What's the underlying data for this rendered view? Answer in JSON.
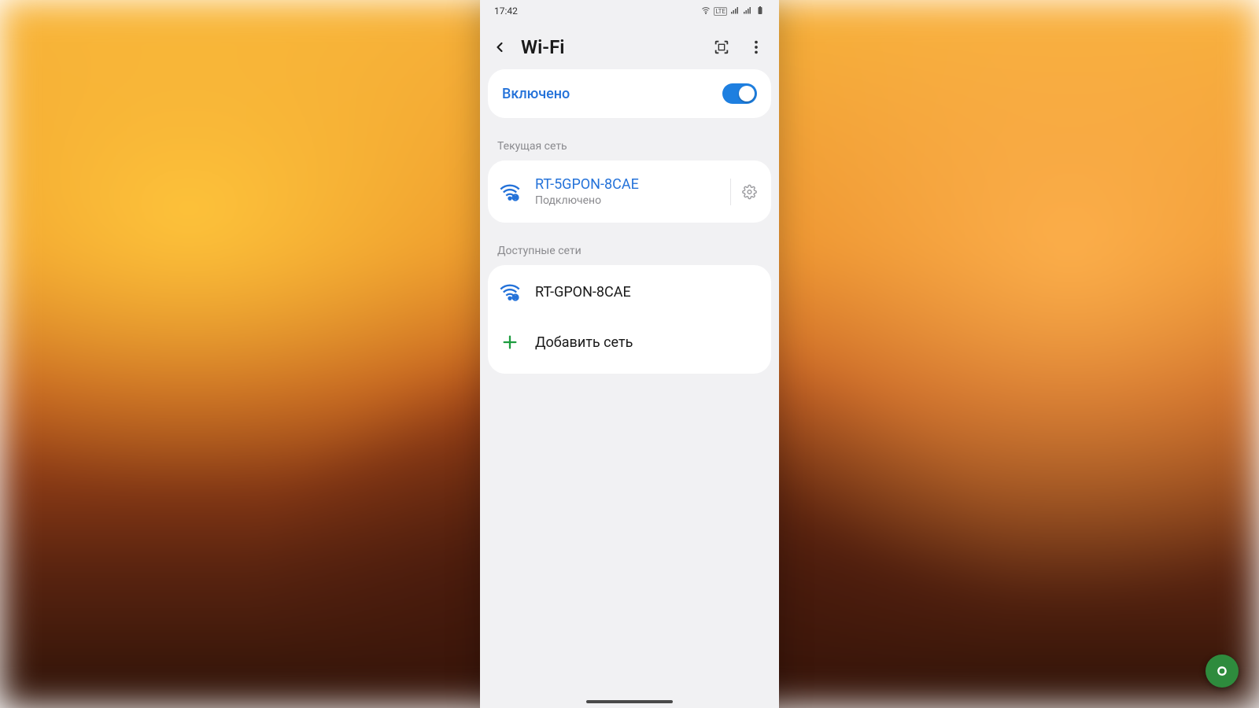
{
  "colors": {
    "accent": "#2472d9",
    "background": "#f1f1f3",
    "card": "#ffffff",
    "muted": "#8a8a8e"
  },
  "statusbar": {
    "time": "17:42"
  },
  "header": {
    "title": "Wi-Fi"
  },
  "toggle": {
    "label": "Включено",
    "enabled": true
  },
  "sections": {
    "current_label": "Текущая сеть",
    "available_label": "Доступные сети"
  },
  "current_network": {
    "ssid": "RT-5GPON-8CAE",
    "status": "Подключено"
  },
  "available_networks": [
    {
      "ssid": "RT-GPON-8CAE"
    }
  ],
  "add_network_label": "Добавить сеть"
}
